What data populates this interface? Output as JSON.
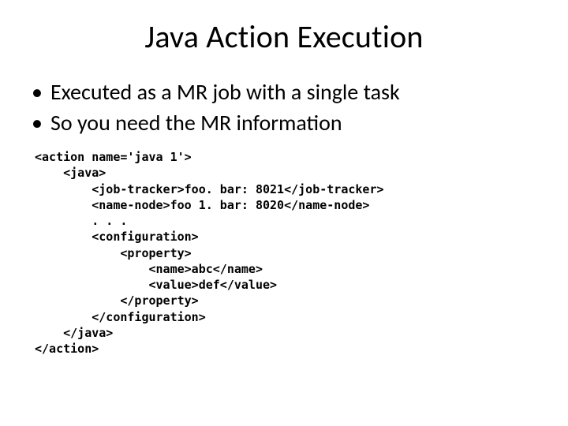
{
  "title": "Java Action Execution",
  "bullets": [
    "Executed as a MR job with a single task",
    "So you need the MR information"
  ],
  "code": {
    "l1": "<action name='java 1'>",
    "l2": "    <java>",
    "l3": "        <job-tracker>foo. bar: 8021</job-tracker>",
    "l4": "        <name-node>foo 1. bar: 8020</name-node>",
    "l5": "        . . .",
    "l6": "        <configuration>",
    "l7": "            <property>",
    "l8": "                <name>abc</name>",
    "l9": "                <value>def</value>",
    "l10": "            </property>",
    "l11": "        </configuration>",
    "l12": "    </java>",
    "l13": "</action>"
  }
}
